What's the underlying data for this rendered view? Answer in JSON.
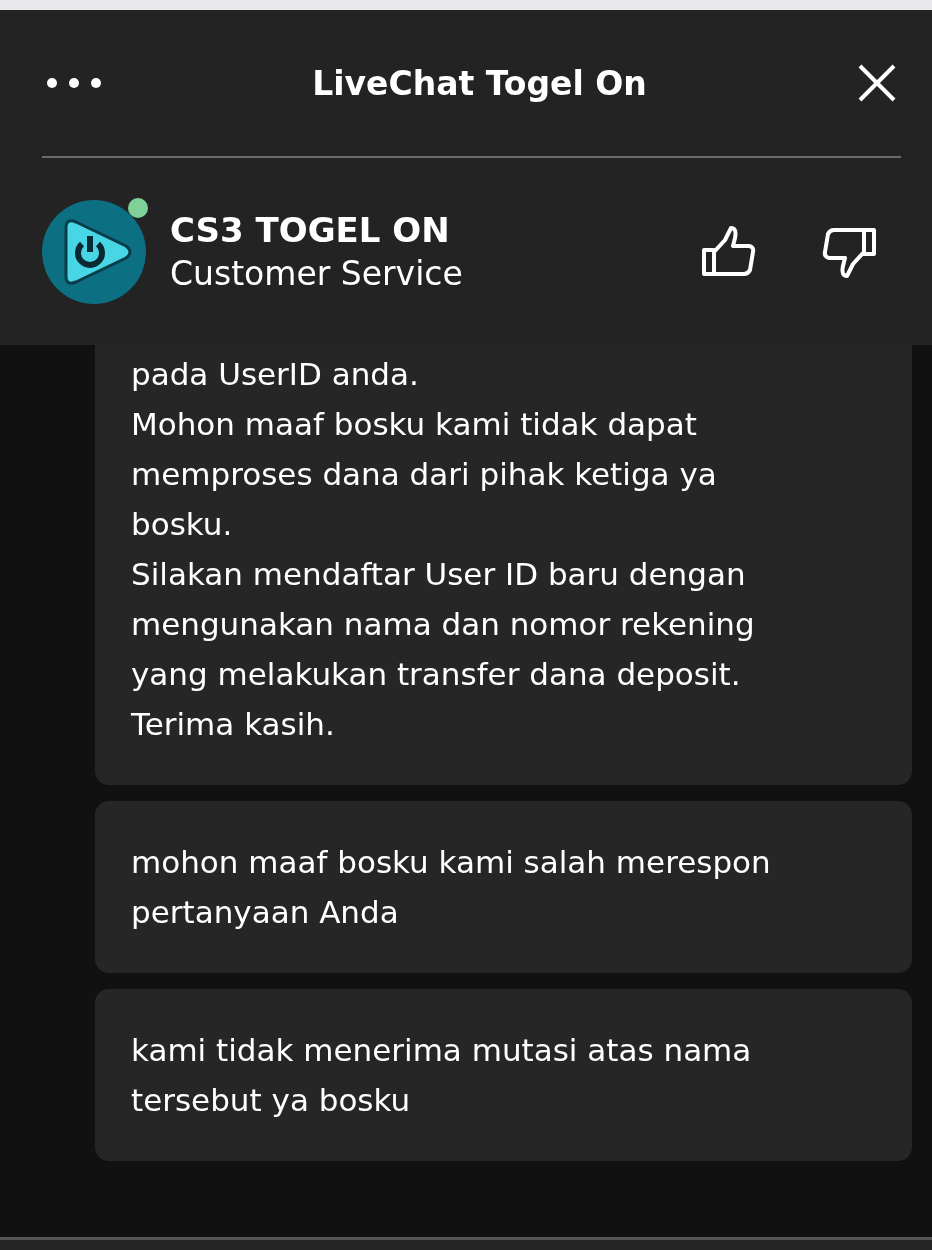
{
  "window": {
    "title": "LiveChat Togel On"
  },
  "agent": {
    "name": "CS3 TOGEL ON",
    "role": "Customer Service",
    "online": true
  },
  "messages": [
    {
      "text": "pada UserID anda.\nMohon maaf bosku kami tidak dapat\nmemproses dana dari pihak ketiga ya\nbosku.\nSilakan mendaftar User ID baru dengan\nmengunakan nama dan nomor rekening\nyang melakukan transfer dana deposit.\nTerima kasih.",
      "continued": true
    },
    {
      "text": "mohon maaf bosku kami salah merespon\npertanyaan Anda",
      "continued": false
    },
    {
      "text": "kami tidak menerima mutasi atas nama\ntersebut ya bosku",
      "continued": false
    }
  ]
}
